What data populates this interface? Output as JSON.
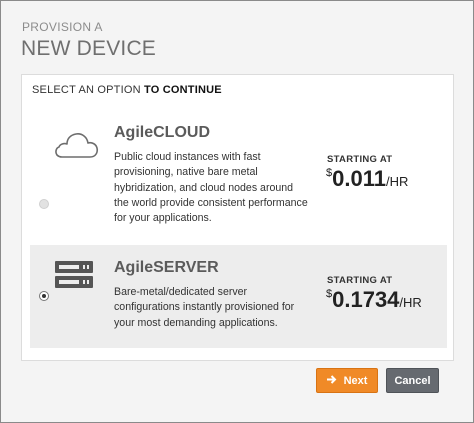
{
  "header": {
    "subtitle": "PROVISION A",
    "title": "NEW DEVICE"
  },
  "panel": {
    "prompt_prefix": "SELECT AN OPTION",
    "prompt_emphasis": "TO CONTINUE"
  },
  "options": [
    {
      "name": "AgileCLOUD",
      "icon": "cloud-icon",
      "selected": false,
      "description": "Public cloud instances with fast provisioning, native bare metal hybridization, and cloud nodes around the world provide consistent performance for your applications.",
      "price_label": "STARTING AT",
      "currency": "$",
      "price": "0.011",
      "unit": "/HR"
    },
    {
      "name": "AgileSERVER",
      "icon": "server-icon",
      "selected": true,
      "description": "Bare-metal/dedicated server configurations instantly provisioned for your most demanding applications.",
      "price_label": "STARTING AT",
      "currency": "$",
      "price": "0.1734",
      "unit": "/HR"
    }
  ],
  "buttons": {
    "next": "Next",
    "cancel": "Cancel"
  },
  "colors": {
    "accent": "#f08a27",
    "secondary": "#666a70",
    "selected_row": "#ededed"
  }
}
